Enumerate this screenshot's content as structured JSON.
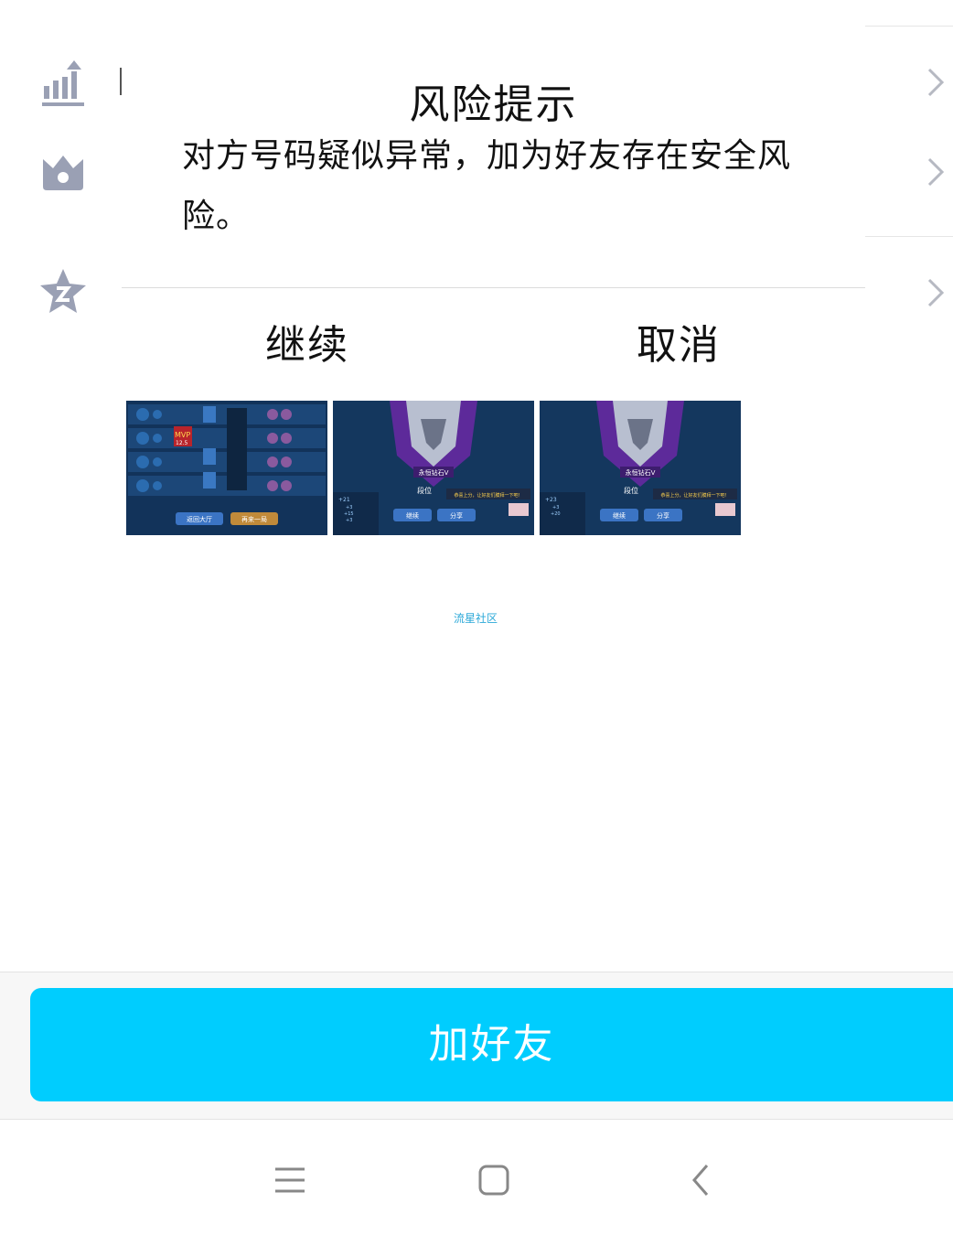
{
  "dialog": {
    "title": "风险提示",
    "message": "对方号码疑似异常，加为好友存在安全风险。",
    "continue_label": "继续",
    "cancel_label": "取消"
  },
  "thumbnails": [
    {
      "kind": "match-result",
      "badge": "MVP",
      "score": "12.5",
      "buttons": [
        "返回大厅",
        "再来一局"
      ]
    },
    {
      "kind": "rank",
      "rank_name": "永恒钻石V",
      "rank_label": "段位",
      "points": [
        "+21",
        "+3",
        "+15",
        "+3"
      ],
      "buttons": [
        "继续",
        "分享"
      ],
      "tip": "恭喜上分，让好友们膜拜一下吧！"
    },
    {
      "kind": "rank",
      "rank_name": "永恒钻石V",
      "rank_label": "段位",
      "points": [
        "+23",
        "+3",
        "+20"
      ],
      "buttons": [
        "继续",
        "分享"
      ],
      "tip": "恭喜上分，让好友们膜拜一下吧！"
    }
  ],
  "footer_label": "流星社区",
  "add_friend_label": "加好友",
  "colors": {
    "accent": "#00cdfe",
    "icon_gray": "#9aa0b4",
    "link_blue": "#2aa8d8"
  },
  "background_rows": [
    {
      "icon": "trend-chart-icon"
    },
    {
      "icon": "crown-icon"
    },
    {
      "icon": "star-badge-icon"
    }
  ],
  "nav": {
    "icons": [
      "menu-icon",
      "home-icon",
      "back-icon"
    ]
  }
}
